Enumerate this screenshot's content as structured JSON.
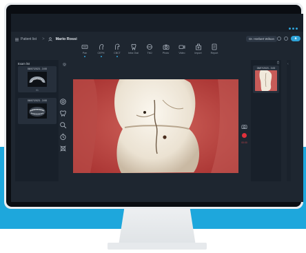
{
  "header": {
    "patient_list_label": "Patient list",
    "breadcrumb_separator": ">",
    "patient_name": "Mario Rossi",
    "doctor_name": "Dr. Herbert Wilson",
    "logo_text": "a"
  },
  "toolbar": {
    "tools": [
      {
        "label": "Pan",
        "icon": "pano-icon",
        "active": true
      },
      {
        "label": "CEPH",
        "icon": "ceph-icon",
        "active": true
      },
      {
        "label": "CBCT",
        "icon": "cbct-icon",
        "active": true
      },
      {
        "label": "Intra Oral",
        "icon": "tooth-icon",
        "active": false
      },
      {
        "label": "TMJ",
        "icon": "tmj-icon",
        "active": false
      },
      {
        "label": "Photo",
        "icon": "camera-icon",
        "active": false
      },
      {
        "label": "Video",
        "icon": "video-icon",
        "active": false
      },
      {
        "label": "Import",
        "icon": "import-icon",
        "active": false
      },
      {
        "label": "Report",
        "icon": "report-icon",
        "active": false
      }
    ]
  },
  "exam_list": {
    "title": "Exam list",
    "cards": [
      {
        "date": "08/07/2023 - 3:00",
        "number": "01"
      },
      {
        "date": "08/07/2023 - 3:00",
        "number": "01"
      }
    ]
  },
  "right_panel": {
    "thumb_date": "08/07/2023 - 3:00"
  },
  "recording": {
    "time": "00:00"
  },
  "colors": {
    "accent": "#2fa3d8",
    "record": "#e1303b",
    "background_band": "#1ea7dc"
  }
}
